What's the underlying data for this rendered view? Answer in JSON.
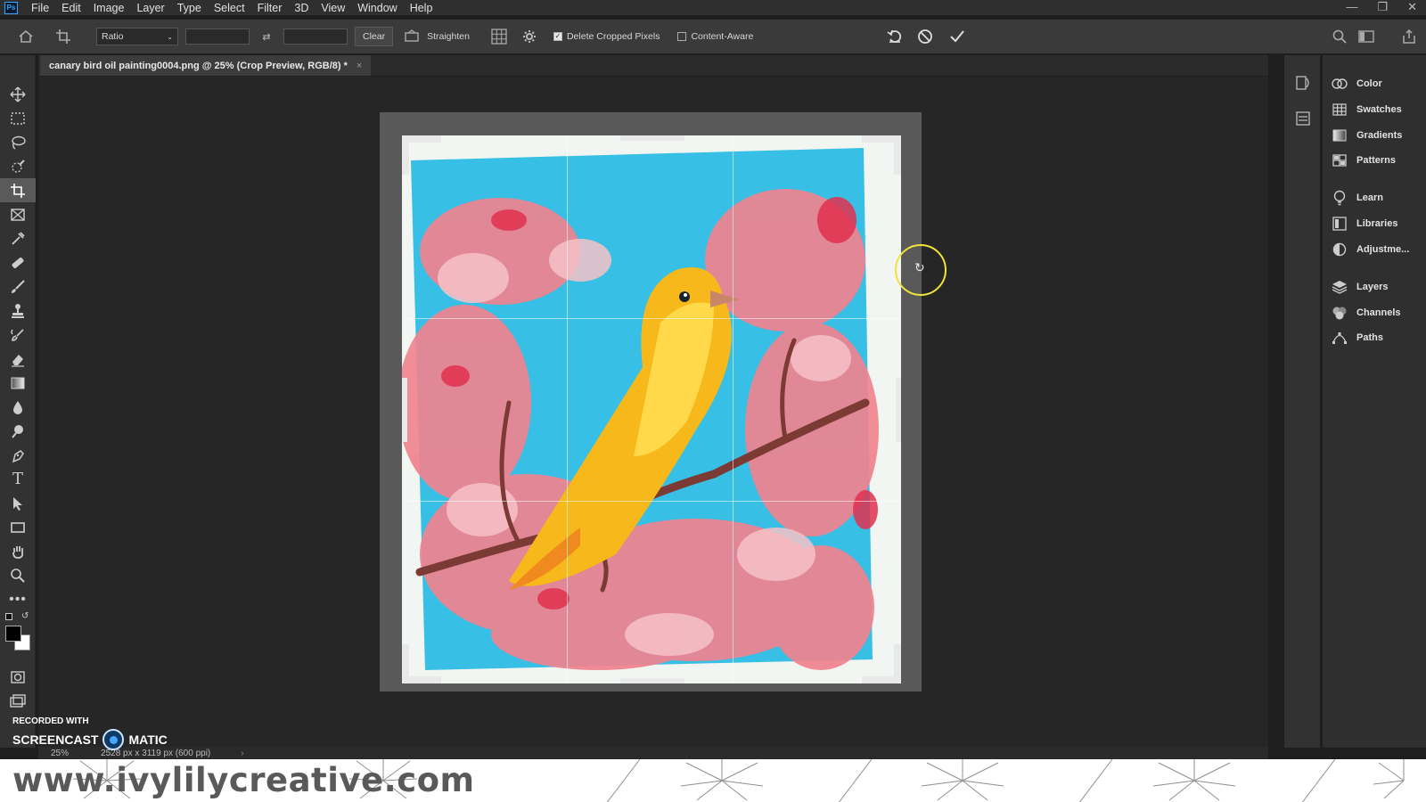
{
  "app": {
    "logo": "Ps"
  },
  "menu": [
    "File",
    "Edit",
    "Image",
    "Layer",
    "Type",
    "Select",
    "Filter",
    "3D",
    "View",
    "Window",
    "Help"
  ],
  "options": {
    "ratio_label": "Ratio",
    "clear_label": "Clear",
    "straighten_label": "Straighten",
    "delete_cropped_label": "Delete Cropped Pixels",
    "delete_cropped_checked": true,
    "content_aware_label": "Content-Aware",
    "content_aware_checked": false
  },
  "document": {
    "tab_title": "canary bird oil painting0004.png @ 25% (Crop Preview, RGB/8) *"
  },
  "tools": [
    "move-tool",
    "marquee-tool",
    "lasso-tool",
    "quick-select-tool",
    "crop-tool",
    "frame-tool",
    "eyedropper-tool",
    "healing-tool",
    "brush-tool",
    "stamp-tool",
    "history-brush-tool",
    "eraser-tool",
    "gradient-tool",
    "blur-tool",
    "dodge-tool",
    "pen-tool",
    "type-tool",
    "path-select-tool",
    "rectangle-tool",
    "hand-tool",
    "zoom-tool",
    "more-tools"
  ],
  "panels": [
    {
      "label": "Color",
      "icon": "color-icon"
    },
    {
      "label": "Swatches",
      "icon": "swatches-icon"
    },
    {
      "label": "Gradients",
      "icon": "gradients-icon"
    },
    {
      "label": "Patterns",
      "icon": "patterns-icon"
    },
    {
      "label": "Learn",
      "icon": "learn-icon"
    },
    {
      "label": "Libraries",
      "icon": "libraries-icon"
    },
    {
      "label": "Adjustme...",
      "icon": "adjustments-icon"
    },
    {
      "label": "Layers",
      "icon": "layers-icon"
    },
    {
      "label": "Channels",
      "icon": "channels-icon"
    },
    {
      "label": "Paths",
      "icon": "paths-icon"
    }
  ],
  "status": {
    "zoom": "25%",
    "size": "2528 px x 3119 px (600 ppi)"
  },
  "watermark": {
    "line1": "RECORDED WITH",
    "brand_a": "SCREENCAST",
    "brand_b": "MATIC"
  },
  "banner": {
    "url": "www.ivylilycreative.com"
  }
}
